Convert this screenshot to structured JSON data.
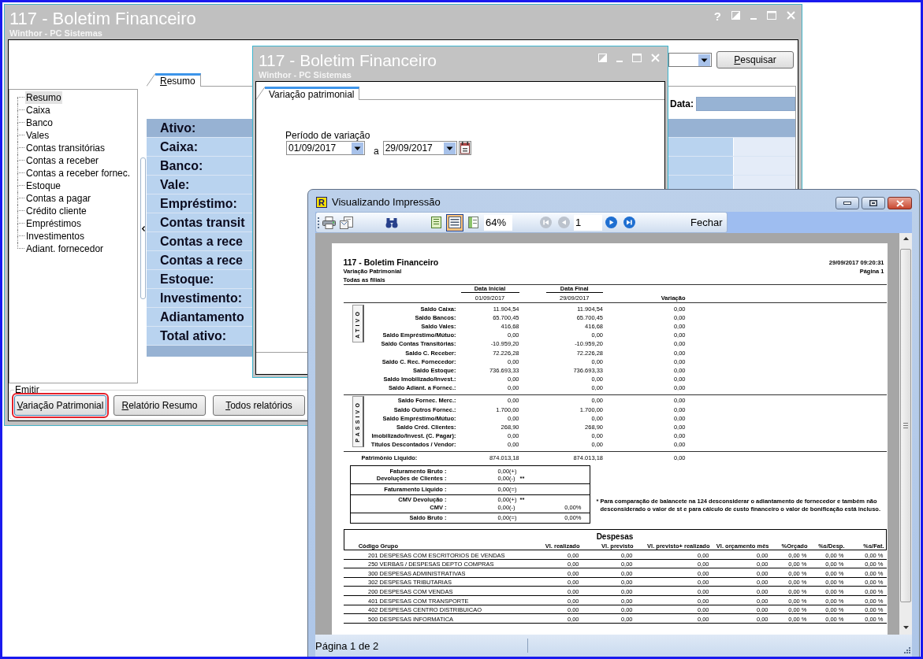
{
  "main_window": {
    "title": "117 - Boletim Financeiro",
    "subtitle": "Winthor - PC Sistemas",
    "help_button": "?",
    "tree": [
      {
        "label": "Resumo",
        "selected": true
      },
      {
        "label": "Caixa",
        "selected": false
      },
      {
        "label": "Banco",
        "selected": false
      },
      {
        "label": "Vales",
        "selected": false
      },
      {
        "label": "Contas transitórias",
        "selected": false
      },
      {
        "label": "Contas a receber",
        "selected": false
      },
      {
        "label": "Contas a receber fornec.",
        "selected": false
      },
      {
        "label": "Estoque",
        "selected": false
      },
      {
        "label": "Contas a pagar",
        "selected": false
      },
      {
        "label": "Crédito cliente",
        "selected": false
      },
      {
        "label": "Empréstimos",
        "selected": false
      },
      {
        "label": "Investimentos",
        "selected": false
      },
      {
        "label": "Adiant. fornecedor",
        "selected": false
      }
    ],
    "tabs": [
      {
        "label": "Resumo",
        "selected": true
      }
    ],
    "search_button": "Pesquisar",
    "date_label": "Data:",
    "summary_rows": [
      {
        "label": "Ativo:",
        "kind": "header"
      },
      {
        "label": "Caixa:",
        "kind": "item"
      },
      {
        "label": "Banco:",
        "kind": "item"
      },
      {
        "label": "Vale:",
        "kind": "item"
      },
      {
        "label": "Empréstimo:",
        "kind": "item"
      },
      {
        "label": "Contas transit",
        "kind": "item"
      },
      {
        "label": "Contas a rece",
        "kind": "item"
      },
      {
        "label": "Contas a rece",
        "kind": "item"
      },
      {
        "label": "Estoque:",
        "kind": "item"
      },
      {
        "label": "Investimento:",
        "kind": "item"
      },
      {
        "label": "Adiantamento",
        "kind": "item"
      },
      {
        "label": "Total ativo:",
        "kind": "item"
      }
    ],
    "emit_group": {
      "label": "Emitir",
      "buttons": [
        {
          "label": "Variação Patrimonial",
          "highlighted": true
        },
        {
          "label": "Relatório Resumo",
          "highlighted": false
        },
        {
          "label": "Todos relatórios",
          "highlighted": false
        }
      ]
    }
  },
  "period_window": {
    "title": "117 - Boletim Financeiro",
    "subtitle": "Winthor - PC Sistemas",
    "tabs": [
      {
        "label": "Variação patrimonial",
        "selected": true
      }
    ],
    "period_label": "Período de variação",
    "start_date": "01/09/2017",
    "separator": "a",
    "end_date": "29/09/2017"
  },
  "preview_window": {
    "icon_letter": "R",
    "title": "Visualizando Impressão",
    "toolbar": {
      "view_modes": [
        {
          "selected": false
        },
        {
          "selected": true
        },
        {
          "selected": false
        }
      ],
      "zoom": "64%",
      "first": {
        "disabled": true
      },
      "previous": {
        "disabled": true
      },
      "page": "1",
      "next": {
        "disabled": false
      },
      "last": {
        "disabled": false
      },
      "close_button": "Fechar"
    },
    "report": {
      "title": "117 - Boletim Financeiro",
      "subtitle": "Variação Patrimonial",
      "scope": "Todas as filiais",
      "timestamp": "29/09/2017 09:20:31",
      "page": "Página 1",
      "columns": [
        "Data Inicial",
        "Data Final",
        "Variação"
      ],
      "dates": [
        "01/09/2017",
        "29/09/2017"
      ],
      "sections": [
        {
          "label": "ATIVO",
          "rows": [
            {
              "label": "Saldo Caixa:",
              "values": [
                "11.904,54",
                "11.904,54",
                "0,00"
              ]
            },
            {
              "label": "Saldo Bancos:",
              "values": [
                "65.700,45",
                "65.700,45",
                "0,00"
              ]
            },
            {
              "label": "Saldo Vales:",
              "values": [
                "416,68",
                "416,68",
                "0,00"
              ]
            },
            {
              "label": "Saldo Empréstimo/Mútuo:",
              "values": [
                "0,00",
                "0,00",
                "0,00"
              ]
            },
            {
              "label": "Saldo Contas Transitórias:",
              "values": [
                "-10.959,20",
                "-10.959,20",
                "0,00"
              ]
            },
            {
              "label": "Saldo C. Receber:",
              "values": [
                "72.226,28",
                "72.226,28",
                "0,00"
              ]
            },
            {
              "label": "Saldo C. Rec. Fornecedor:",
              "values": [
                "0,00",
                "0,00",
                "0,00"
              ]
            },
            {
              "label": "Saldo Estoque:",
              "values": [
                "736.693,33",
                "736.693,33",
                "0,00"
              ]
            },
            {
              "label": "Saldo Imobilizado/Invest.:",
              "values": [
                "0,00",
                "0,00",
                "0,00"
              ]
            },
            {
              "label": "Saldo Adiant. a Fornec.:",
              "values": [
                "0,00",
                "0,00",
                "0,00"
              ]
            }
          ]
        },
        {
          "label": "PASSIVO",
          "rows": [
            {
              "label": "Saldo Fornec. Merc.:",
              "values": [
                "0,00",
                "0,00",
                "0,00"
              ]
            },
            {
              "label": "Saldo Outros Fornec.:",
              "values": [
                "1.700,00",
                "1.700,00",
                "0,00"
              ]
            },
            {
              "label": "Saldo Empréstimo/Mútuo:",
              "values": [
                "0,00",
                "0,00",
                "0,00"
              ]
            },
            {
              "label": "Saldo Créd. Clientes:",
              "values": [
                "268,90",
                "268,90",
                "0,00"
              ]
            },
            {
              "label": "Imobilizado/Invest. (C. Pagar):",
              "values": [
                "0,00",
                "0,00",
                "0,00"
              ]
            },
            {
              "label": "Titulos Descontados / Vendor:",
              "values": [
                "0,00",
                "0,00",
                "0,00"
              ]
            }
          ]
        }
      ],
      "total": {
        "label": "Patrimônio Liquido:",
        "values": [
          "874.013,18",
          "874.013,18",
          "0,00"
        ]
      },
      "gross_box": [
        {
          "rows": [
            {
              "label": "Faturamento Bruto :",
              "value": "0,00(+)"
            },
            {
              "label": "Devoluções de Clientes :",
              "value": "0,00(-)",
              "mark": "**"
            }
          ]
        },
        {
          "rows": [
            {
              "label": "Faturamento Liquido :",
              "value": "0,00(=)"
            }
          ]
        },
        {
          "rows": [
            {
              "label": "CMV Devolução :",
              "value": "0,00(+)",
              "mark": "**"
            },
            {
              "label": "CMV :",
              "value": "0,00(-)",
              "percent": "0,00%"
            }
          ]
        },
        {
          "rows": [
            {
              "label": "Saldo Bruto :",
              "value": "0,00(=)",
              "percent": "0,00%"
            }
          ]
        }
      ],
      "note": [
        "* Para comparação de balancete na 124 desconsiderar o adiantamento de fornecedor e também não",
        "desconsiderado o valor de st e para cálculo de custo financeiro o valor de bonificação está incluso."
      ],
      "expenses": {
        "title": "Despesas",
        "columns": [
          "Código",
          "Grupo",
          "Vl. realizado",
          "Vl. previsto",
          "Vl. previsto+ realizado",
          "Vl. orçamento mês",
          "%Orçado",
          "%s/Desp.",
          "%s/Fat."
        ],
        "rows": [
          {
            "code": "201",
            "group": "DESPESAS COM ESCRITORIOS DE VENDAS",
            "values": [
              "0,00",
              "0,00",
              "0,00",
              "0,00",
              "0,00 %",
              "0,00 %",
              "0,00 %"
            ]
          },
          {
            "code": "250",
            "group": "VERBAS / DESPESAS DEPTO COMPRAS",
            "values": [
              "0,00",
              "0,00",
              "0,00",
              "0,00",
              "0,00 %",
              "0,00 %",
              "0,00 %"
            ]
          },
          {
            "code": "300",
            "group": "DESPESAS ADMINISTRATIVAS",
            "values": [
              "0,00",
              "0,00",
              "0,00",
              "0,00",
              "0,00 %",
              "0,00 %",
              "0,00 %"
            ]
          },
          {
            "code": "302",
            "group": "DESPESAS TRIBUTARIAS",
            "values": [
              "0,00",
              "0,00",
              "0,00",
              "0,00",
              "0,00 %",
              "0,00 %",
              "0,00 %"
            ]
          },
          {
            "code": "200",
            "group": "DESPESAS COM VENDAS",
            "values": [
              "0,00",
              "0,00",
              "0,00",
              "0,00",
              "0,00 %",
              "0,00 %",
              "0,00 %"
            ]
          },
          {
            "code": "401",
            "group": "DESPESAS COM TRANSPORTE",
            "values": [
              "0,00",
              "0,00",
              "0,00",
              "0,00",
              "0,00 %",
              "0,00 %",
              "0,00 %"
            ]
          },
          {
            "code": "402",
            "group": "DESPESAS CENTRO DISTRIBUICAO",
            "values": [
              "0,00",
              "0,00",
              "0,00",
              "0,00",
              "0,00 %",
              "0,00 %",
              "0,00 %"
            ]
          },
          {
            "code": "500",
            "group": "DESPESAS INFORMATICA",
            "values": [
              "0,00",
              "0,00",
              "0,00",
              "0,00",
              "0,00 %",
              "0,00 %",
              "0,00 %"
            ]
          }
        ]
      }
    },
    "status_bar": "Página 1 de 2"
  }
}
